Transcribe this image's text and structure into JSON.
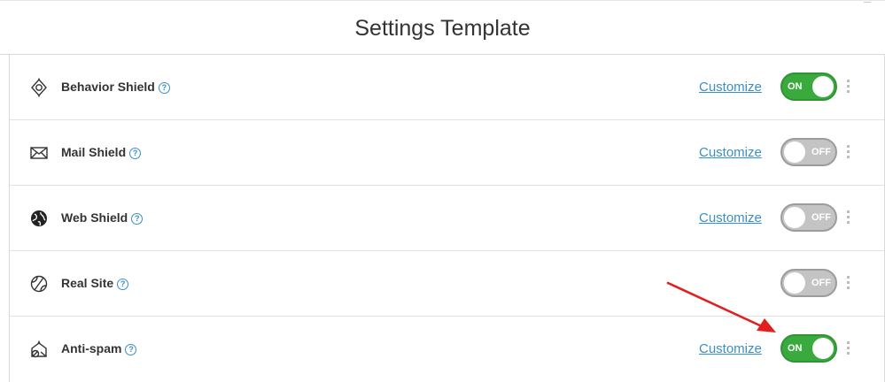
{
  "header": {
    "title": "Settings Template"
  },
  "rows": [
    {
      "label": "Behavior Shield",
      "icon": "behavior-shield-icon",
      "customize": "Customize",
      "state": "ON",
      "on": true
    },
    {
      "label": "Mail Shield",
      "icon": "envelope-icon",
      "customize": "Customize",
      "state": "OFF",
      "on": false
    },
    {
      "label": "Web Shield",
      "icon": "globe-icon",
      "customize": "Customize",
      "state": "OFF",
      "on": false
    },
    {
      "label": "Real Site",
      "icon": "real-site-globe-icon",
      "customize": "",
      "state": "OFF",
      "on": false
    },
    {
      "label": "Anti-spam",
      "icon": "anti-spam-icon",
      "customize": "Customize",
      "state": "ON",
      "on": true
    }
  ],
  "help_glyph": "?",
  "colors": {
    "accent": "#3a8fc5",
    "on": "#3aaa3e",
    "off": "#c4c4c4",
    "arrow": "#e02020"
  }
}
